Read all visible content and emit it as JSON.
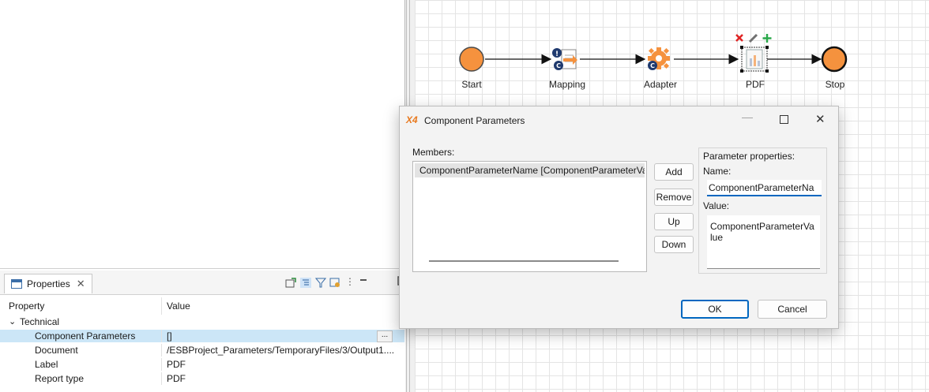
{
  "diagram": {
    "nodes": [
      {
        "label": "Start",
        "kind": "start-event"
      },
      {
        "label": "Mapping",
        "kind": "mapping-task"
      },
      {
        "label": "Adapter",
        "kind": "adapter-task"
      },
      {
        "label": "PDF",
        "kind": "pdf-task",
        "selected": true
      },
      {
        "label": "Stop",
        "kind": "end-event"
      }
    ],
    "event_color": "#f5923e",
    "selection_actions": [
      "delete-icon",
      "edit-icon",
      "add-icon"
    ]
  },
  "properties_view": {
    "tab_label": "Properties",
    "columns": [
      "Property",
      "Value"
    ],
    "category": "Technical",
    "rows": [
      {
        "name": "Component Parameters",
        "value": "[]",
        "selected": true
      },
      {
        "name": "Document",
        "value": "/ESBProject_Parameters/TemporaryFiles/3/Output1...."
      },
      {
        "name": "Label",
        "value": "PDF"
      },
      {
        "name": "Report type",
        "value": "PDF"
      }
    ],
    "ellipsis_label": "...",
    "selected_row_color": "#cce6f7"
  },
  "dialog": {
    "app_badge": "X4",
    "title": "Component Parameters",
    "members_label": "Members:",
    "members": [
      "ComponentParameterName [ComponentParameterVa"
    ],
    "buttons": {
      "add": "Add",
      "remove": "Remove",
      "up": "Up",
      "down": "Down",
      "ok": "OK",
      "cancel": "Cancel"
    },
    "param_group_label": "Parameter properties:",
    "name_label": "Name:",
    "name_value": "ComponentParameterNa",
    "value_label": "Value:",
    "value_lines": [
      "ComponentParameterVa",
      "lue"
    ],
    "accent_color": "#0067c0"
  }
}
